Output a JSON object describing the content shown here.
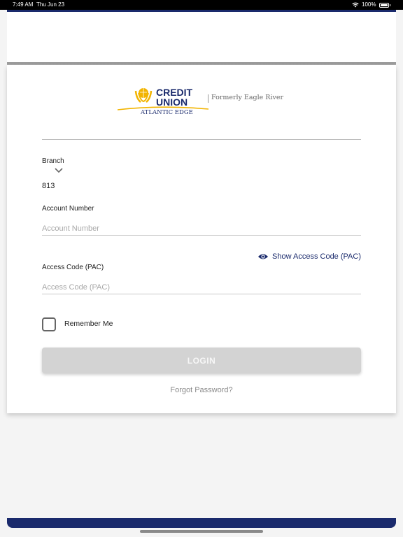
{
  "status_bar": {
    "time": "7:49 AM",
    "date": "Thu Jun 23",
    "battery": "100%"
  },
  "logo": {
    "line1": "CREDIT",
    "line2": "UNION",
    "line3": "ATLANTIC EDGE",
    "formerly": "Formerly Eagle River"
  },
  "form": {
    "branch_label": "Branch",
    "branch_value": "813",
    "account_label": "Account Number",
    "account_placeholder": "Account Number",
    "show_pac": "Show Access Code (PAC)",
    "pac_label": "Access Code (PAC)",
    "pac_placeholder": "Access Code (PAC)",
    "remember_label": "Remember Me",
    "remember_checked": false,
    "login_label": "LOGIN",
    "forgot_label": "Forgot Password?"
  },
  "colors": {
    "brand_navy": "#1a2a6c",
    "brand_gold": "#f2b400",
    "button_disabled": "#d3d3d3"
  },
  "icons": {
    "wifi": "wifi-icon",
    "battery": "battery-icon",
    "chevron": "chevron-down-icon",
    "eye": "eye-icon"
  }
}
